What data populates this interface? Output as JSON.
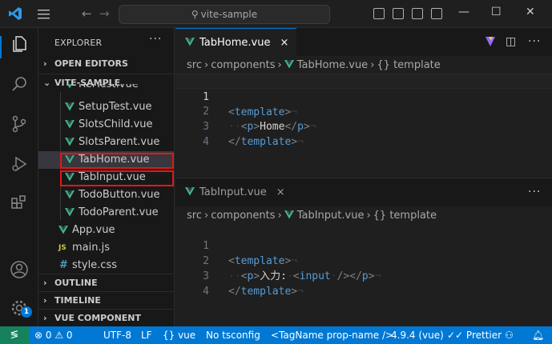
{
  "titlebar": {
    "search_text": "vite-sample"
  },
  "sidebar": {
    "title": "EXPLORER",
    "more": "···",
    "sections": {
      "open_editors": "OPEN EDITORS",
      "project": "VITE-SAMPLE",
      "outline": "OUTLINE",
      "timeline": "TIMELINE",
      "vue_preview": "VUE COMPONENT PREVIEW"
    },
    "files": [
      {
        "name": "RefTest.vue",
        "type": "vue"
      },
      {
        "name": "SetupTest.vue",
        "type": "vue"
      },
      {
        "name": "SlotsChild.vue",
        "type": "vue"
      },
      {
        "name": "SlotsParent.vue",
        "type": "vue"
      },
      {
        "name": "TabHome.vue",
        "type": "vue"
      },
      {
        "name": "TabInput.vue",
        "type": "vue"
      },
      {
        "name": "TodoButton.vue",
        "type": "vue"
      },
      {
        "name": "TodoParent.vue",
        "type": "vue"
      },
      {
        "name": "App.vue",
        "type": "vue"
      },
      {
        "name": "main.js",
        "type": "js"
      },
      {
        "name": "style.css",
        "type": "css"
      }
    ],
    "js_icon": "JS",
    "css_icon": "#",
    "badge_count": "1"
  },
  "editor1": {
    "tab_label": "TabHome.vue",
    "close_glyph": "×",
    "breadcrumbs": {
      "src": "src",
      "components": "components",
      "file": "TabHome.vue",
      "symbol": "{} template"
    },
    "lines": [
      {
        "num": "1",
        "parts": [
          "<",
          "template",
          ">"
        ]
      },
      {
        "num": "2",
        "parts": [
          "<",
          "p",
          ">",
          "Home",
          "</",
          "p",
          ">"
        ]
      },
      {
        "num": "3",
        "parts": [
          "</",
          "template",
          ">"
        ]
      },
      {
        "num": "4",
        "parts": []
      }
    ]
  },
  "editor2": {
    "tab_label": "TabInput.vue",
    "close_glyph": "×",
    "more": "···",
    "breadcrumbs": {
      "src": "src",
      "components": "components",
      "file": "TabInput.vue",
      "symbol": "{} template"
    },
    "lines": [
      {
        "num": "1",
        "parts": [
          "<",
          "template",
          ">"
        ]
      },
      {
        "num": "2",
        "parts": [
          "<",
          "p",
          ">",
          "入力:",
          "<",
          "input",
          "/>",
          "</",
          "p",
          ">"
        ]
      },
      {
        "num": "3",
        "parts": [
          "</",
          "template",
          ">"
        ]
      },
      {
        "num": "4",
        "parts": []
      }
    ]
  },
  "statusbar": {
    "remote_glyph": "≶",
    "problems": "⊗ 0 ⚠ 0",
    "encoding": "UTF-8",
    "eol": "LF",
    "language": "{} vue",
    "tsconfig": "No tsconfig",
    "tag_name": "<TagName prop-name />",
    "version": "4.9.4 (vue)",
    "prettier": "✓✓ Prettier"
  },
  "colors": {
    "accent": "#0078d4",
    "vue_green": "#41b883",
    "highlight_box": "#e01818",
    "remote": "#16825d"
  }
}
